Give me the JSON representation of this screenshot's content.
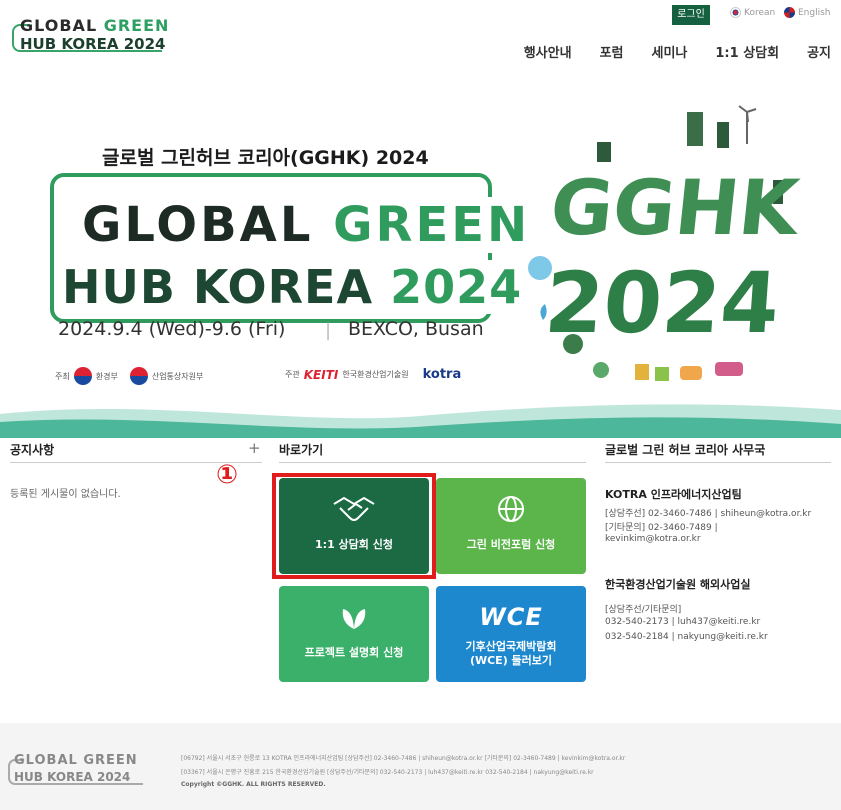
{
  "header": {
    "logo_line1a": "GLOBAL ",
    "logo_line1b": "GREEN",
    "logo_line2": "HUB KOREA 2024",
    "login": "로그인",
    "lang_korean": "Korean",
    "lang_english": "English",
    "nav": [
      "행사안내",
      "포럼",
      "세미나",
      "1:1 상담회",
      "공지"
    ]
  },
  "hero": {
    "subtitle": "글로벌 그린허브 코리아(GGHK) 2024",
    "title1a": "GLOBAL ",
    "title1b": "GREEN",
    "title2a": "HUB KOREA ",
    "title2b": "2024",
    "date": "2024.9.4 (Wed)-9.6 (Fri)",
    "sep": "|",
    "venue": "BEXCO, Busan",
    "host_label": "주최",
    "host1": "환경부",
    "host2": "산업통상자원부",
    "organizer_label": "주관",
    "org_keiti": "KEITI",
    "org_keiti_name": "한국환경산업기술원",
    "org_kotra": "kotra",
    "art_line1": "GGHK",
    "art_line2": "2024"
  },
  "notice": {
    "title": "공지사항",
    "plus": "+",
    "empty": "등록된 게시물이 없습니다."
  },
  "shortcuts": {
    "title": "바로가기",
    "marker": "①",
    "tiles": [
      {
        "label": "1:1 상담회 신청",
        "icon": "handshake-icon"
      },
      {
        "label": "그린 비전포럼 신청",
        "icon": "globe-icon"
      },
      {
        "label": "프로젝트 설명회 신청",
        "icon": "leaf-icon"
      },
      {
        "label": "기후산업국제박람회\n(WCE) 둘러보기",
        "icon": "wce-logo",
        "logo_text": "WCE"
      }
    ]
  },
  "office": {
    "title": "글로벌 그린 허브 코리아 사무국",
    "kotra_name": "KOTRA 인프라에너지산업팀",
    "kotra_l1": "[상담주선] 02-3460-7486 | shiheun@kotra.or.kr",
    "kotra_l2": "[기타문의] 02-3460-7489 |",
    "kotra_l3": "kevinkim@kotra.or.kr",
    "keiti_name": "한국환경산업기술원 해외사업실",
    "keiti_l1": "[상담주선/기타문의]",
    "keiti_l2": "032-540-2173 | luh437@keiti.re.kr",
    "keiti_l3": "032-540-2184 | nakyung@keiti.re.kr"
  },
  "footer": {
    "logo_l1": "GLOBAL GREEN",
    "logo_l2": "HUB KOREA 2024",
    "line1": "[06792] 서울시 서초구 헌릉로 13 KOTRA 인프라에너지산업팀     [상담주선] 02-3460-7486 | shiheun@kotra.or.kr [기타문의] 02-3460-7489 | kevinkim@kotra.or.kr",
    "line2": "[03367] 서울시 은평구 진흥로 215 한국환경산업기술원     [상담주선/기타문의] 032-540-2173 | luh437@keiti.re.kr 032-540-2184 | nakyung@keiti.re.kr",
    "copyright": "Copyright ©GGHK. ALL RIGHTS RESERVED."
  },
  "colors": {
    "brand_green": "#1b6a44",
    "accent_green": "#2f9c5e",
    "highlight_red": "#e01c1c",
    "wce_blue": "#1e88cf"
  }
}
